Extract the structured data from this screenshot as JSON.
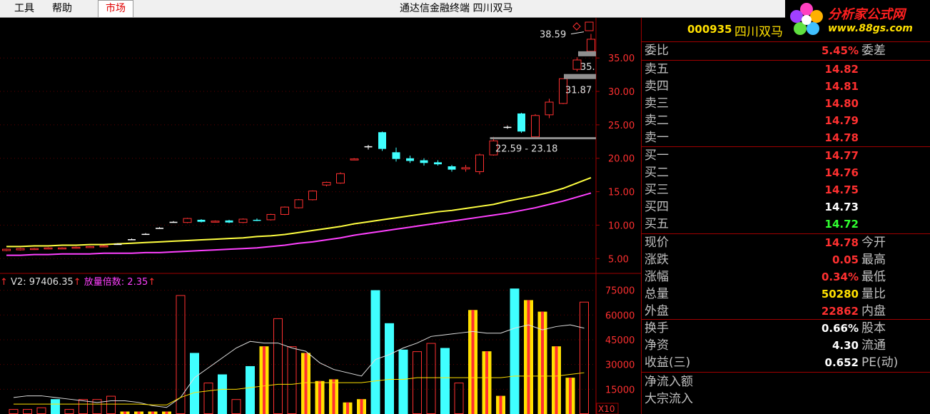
{
  "menu": {
    "tools": "工具",
    "help": "帮助",
    "market": "市场"
  },
  "window_title": "通达信金融终端  四川双马",
  "logo": {
    "text": "分析家公式网",
    "url": "www.88gs.com"
  },
  "stock": {
    "code": "000935",
    "name": "四川双马"
  },
  "quote_panel": {
    "ratio_label": "委比",
    "ratio_value": "5.45%",
    "diff_label": "委差",
    "asks": [
      {
        "label": "卖五",
        "price": "14.82"
      },
      {
        "label": "卖四",
        "price": "14.81"
      },
      {
        "label": "卖三",
        "price": "14.80"
      },
      {
        "label": "卖二",
        "price": "14.79"
      },
      {
        "label": "卖一",
        "price": "14.78"
      }
    ],
    "bids": [
      {
        "label": "买一",
        "price": "14.77"
      },
      {
        "label": "买二",
        "price": "14.76"
      },
      {
        "label": "买三",
        "price": "14.75"
      },
      {
        "label": "买四",
        "price": "14.73"
      },
      {
        "label": "买五",
        "price": "14.72"
      }
    ],
    "stats": [
      {
        "label": "现价",
        "value": "14.78",
        "label2": "今开"
      },
      {
        "label": "涨跌",
        "value": "0.05",
        "label2": "最高"
      },
      {
        "label": "涨幅",
        "value": "0.34%",
        "label2": "最低"
      },
      {
        "label": "总量",
        "value": "50280",
        "label2": "量比"
      },
      {
        "label": "外盘",
        "value": "22862",
        "label2": "内盘"
      }
    ],
    "stats2": [
      {
        "label": "换手",
        "value": "0.66%",
        "label2": "股本"
      },
      {
        "label": "净资",
        "value": "4.30",
        "label2": "流通"
      },
      {
        "label": "收益(三)",
        "value": "0.652",
        "label2": "PE(动)"
      }
    ],
    "flows": [
      {
        "label": "净流入额"
      },
      {
        "label": "大宗流入"
      }
    ],
    "colors": {
      "up": "#ff3030",
      "down": "#30ff30",
      "flat": "#ffffff",
      "volume": "#ffe000"
    }
  },
  "volume_legend": {
    "v2": "V2: 97406.35",
    "ratio": "放量倍数: 2.35"
  },
  "chart_data": {
    "type": "candlestick",
    "price_axis": {
      "ticks": [
        "35.00",
        "30.00",
        "25.00",
        "20.00",
        "15.00",
        "10.00",
        "5.00"
      ],
      "ylim": [
        3.0,
        41.0
      ]
    },
    "volume_axis": {
      "ticks": [
        "75000",
        "60000",
        "45000",
        "30000",
        "15000"
      ],
      "ylim": [
        0,
        80000
      ],
      "unit_label": "X10"
    },
    "annotations": {
      "high": "38.59",
      "mark1": "35.",
      "mark2": "31.87",
      "range": "22.59 - 23.18"
    },
    "candles": [
      {
        "o": 6.2,
        "c": 6.4,
        "h": 6.5,
        "l": 6.1
      },
      {
        "o": 6.3,
        "c": 6.5,
        "h": 6.6,
        "l": 6.2
      },
      {
        "o": 6.4,
        "c": 6.5,
        "h": 6.6,
        "l": 6.3
      },
      {
        "o": 6.5,
        "c": 6.6,
        "h": 6.7,
        "l": 6.4
      },
      {
        "o": 6.5,
        "c": 6.6,
        "h": 6.7,
        "l": 6.4
      },
      {
        "o": 6.6,
        "c": 6.7,
        "h": 6.8,
        "l": 6.5
      },
      {
        "o": 6.7,
        "c": 6.8,
        "h": 6.9,
        "l": 6.6
      },
      {
        "o": 6.8,
        "c": 6.9,
        "h": 7.0,
        "l": 6.7
      },
      {
        "o": 7.2,
        "c": 7.2,
        "h": 7.3,
        "l": 7.1
      },
      {
        "o": 7.9,
        "c": 7.9,
        "h": 8.0,
        "l": 7.8
      },
      {
        "o": 8.7,
        "c": 8.7,
        "h": 8.8,
        "l": 8.6
      },
      {
        "o": 9.6,
        "c": 9.6,
        "h": 9.7,
        "l": 9.5
      },
      {
        "o": 10.5,
        "c": 10.5,
        "h": 10.6,
        "l": 10.4
      },
      {
        "o": 10.4,
        "c": 11.0,
        "h": 11.1,
        "l": 10.3
      },
      {
        "o": 10.8,
        "c": 10.5,
        "h": 10.9,
        "l": 10.4
      },
      {
        "o": 10.5,
        "c": 10.6,
        "h": 10.7,
        "l": 10.4
      },
      {
        "o": 10.7,
        "c": 10.4,
        "h": 10.8,
        "l": 10.3
      },
      {
        "o": 10.4,
        "c": 10.9,
        "h": 11.0,
        "l": 10.3
      },
      {
        "o": 10.8,
        "c": 10.7,
        "h": 11.0,
        "l": 10.6
      },
      {
        "o": 10.8,
        "c": 11.6,
        "h": 11.7,
        "l": 10.7
      },
      {
        "o": 11.6,
        "c": 12.7,
        "h": 12.8,
        "l": 11.5
      },
      {
        "o": 12.6,
        "c": 13.8,
        "h": 13.9,
        "l": 12.5
      },
      {
        "o": 13.8,
        "c": 15.1,
        "h": 15.2,
        "l": 13.7
      },
      {
        "o": 16.0,
        "c": 16.4,
        "h": 16.5,
        "l": 15.8
      },
      {
        "o": 16.3,
        "c": 17.7,
        "h": 17.9,
        "l": 16.2
      },
      {
        "o": 19.8,
        "c": 19.9,
        "h": 20.0,
        "l": 19.7
      },
      {
        "o": 21.8,
        "c": 21.8,
        "h": 22.0,
        "l": 21.3
      },
      {
        "o": 23.9,
        "c": 21.4,
        "h": 24.0,
        "l": 21.1
      },
      {
        "o": 20.9,
        "c": 19.9,
        "h": 21.6,
        "l": 19.5
      },
      {
        "o": 20.0,
        "c": 19.6,
        "h": 20.4,
        "l": 19.3
      },
      {
        "o": 19.7,
        "c": 19.3,
        "h": 20.0,
        "l": 18.9
      },
      {
        "o": 19.4,
        "c": 19.1,
        "h": 19.7,
        "l": 18.9
      },
      {
        "o": 18.8,
        "c": 18.3,
        "h": 19.0,
        "l": 18.0
      },
      {
        "o": 18.4,
        "c": 18.6,
        "h": 19.0,
        "l": 18.0
      },
      {
        "o": 18.0,
        "c": 20.5,
        "h": 20.7,
        "l": 17.6
      },
      {
        "o": 20.5,
        "c": 22.6,
        "h": 23.2,
        "l": 20.4
      },
      {
        "o": 24.7,
        "c": 24.7,
        "h": 24.9,
        "l": 24.4
      },
      {
        "o": 26.7,
        "c": 24.0,
        "h": 26.8,
        "l": 23.8
      },
      {
        "o": 23.2,
        "c": 26.4,
        "h": 26.6,
        "l": 23.0
      },
      {
        "o": 26.5,
        "c": 28.4,
        "h": 28.9,
        "l": 26.0
      },
      {
        "o": 28.2,
        "c": 31.9,
        "h": 31.9,
        "l": 28.1
      },
      {
        "o": 33.3,
        "c": 34.7,
        "h": 35.1,
        "l": 33.0
      },
      {
        "o": 36.0,
        "c": 37.8,
        "h": 38.6,
        "l": 35.4
      }
    ],
    "ma_short": [
      6.8,
      6.8,
      6.9,
      6.9,
      7.0,
      7.0,
      7.1,
      7.1,
      7.2,
      7.3,
      7.4,
      7.5,
      7.6,
      7.7,
      7.8,
      7.9,
      8.0,
      8.1,
      8.3,
      8.4,
      8.6,
      8.9,
      9.2,
      9.5,
      9.8,
      10.2,
      10.5,
      10.8,
      11.1,
      11.4,
      11.7,
      12.0,
      12.2,
      12.5,
      12.8,
      13.1,
      13.6,
      14.0,
      14.4,
      14.9,
      15.5,
      16.3,
      17.1
    ],
    "ma_long": [
      5.5,
      5.5,
      5.6,
      5.6,
      5.7,
      5.7,
      5.7,
      5.8,
      5.8,
      5.8,
      5.9,
      5.9,
      6.0,
      6.1,
      6.2,
      6.3,
      6.4,
      6.5,
      6.6,
      6.8,
      7.0,
      7.3,
      7.5,
      7.8,
      8.1,
      8.5,
      8.8,
      9.1,
      9.4,
      9.7,
      10.0,
      10.3,
      10.6,
      10.9,
      11.2,
      11.5,
      11.8,
      12.2,
      12.6,
      13.1,
      13.6,
      14.2,
      14.8
    ],
    "volumes": [
      {
        "v": 3000,
        "k": "up"
      },
      {
        "v": 3000,
        "k": "up"
      },
      {
        "v": 4000,
        "k": "up"
      },
      {
        "v": 9000,
        "k": "down"
      },
      {
        "v": 3000,
        "k": "up"
      },
      {
        "v": 9000,
        "k": "up"
      },
      {
        "v": 9000,
        "k": "up"
      },
      {
        "v": 11000,
        "k": "up"
      },
      {
        "v": 1500,
        "k": "flat"
      },
      {
        "v": 1500,
        "k": "flat"
      },
      {
        "v": 1500,
        "k": "flat"
      },
      {
        "v": 1500,
        "k": "flat"
      },
      {
        "v": 72000,
        "k": "up"
      },
      {
        "v": 37000,
        "k": "down"
      },
      {
        "v": 19000,
        "k": "up"
      },
      {
        "v": 24000,
        "k": "down"
      },
      {
        "v": 9000,
        "k": "up"
      },
      {
        "v": 29000,
        "k": "down"
      },
      {
        "v": 41000,
        "k": "flat"
      },
      {
        "v": 58000,
        "k": "up"
      },
      {
        "v": 41000,
        "k": "up"
      },
      {
        "v": 37000,
        "k": "flat"
      },
      {
        "v": 20000,
        "k": "flat"
      },
      {
        "v": 21000,
        "k": "flat"
      },
      {
        "v": 7000,
        "k": "flat"
      },
      {
        "v": 9000,
        "k": "flat"
      },
      {
        "v": 75000,
        "k": "down"
      },
      {
        "v": 55000,
        "k": "down"
      },
      {
        "v": 39000,
        "k": "down"
      },
      {
        "v": 38000,
        "k": "up"
      },
      {
        "v": 43000,
        "k": "up"
      },
      {
        "v": 40000,
        "k": "down"
      },
      {
        "v": 19000,
        "k": "up"
      },
      {
        "v": 63000,
        "k": "flat"
      },
      {
        "v": 38000,
        "k": "flat"
      },
      {
        "v": 11000,
        "k": "flat"
      },
      {
        "v": 76000,
        "k": "down"
      },
      {
        "v": 69000,
        "k": "flat"
      },
      {
        "v": 62000,
        "k": "flat"
      },
      {
        "v": 41000,
        "k": "flat"
      },
      {
        "v": 22000,
        "k": "flat"
      },
      {
        "v": 68000,
        "k": "up"
      }
    ],
    "vol_ma1": [
      10000,
      11000,
      11000,
      10000,
      9000,
      8000,
      7000,
      8000,
      8000,
      7000,
      5000,
      4000,
      10000,
      22000,
      28000,
      34000,
      40000,
      44000,
      43000,
      43000,
      40000,
      38000,
      31000,
      27000,
      25000,
      23000,
      33000,
      36000,
      40000,
      43000,
      47000,
      48000,
      49000,
      50000,
      49000,
      49000,
      52000,
      54000,
      51000,
      53000,
      54000,
      52000
    ],
    "vol_ma2": [
      6000,
      6000,
      6000,
      6000,
      6000,
      6000,
      6000,
      6000,
      6000,
      6000,
      5500,
      5500,
      10000,
      13000,
      14000,
      15000,
      15000,
      16000,
      17000,
      18000,
      18000,
      19000,
      19000,
      19000,
      19000,
      19000,
      20000,
      21000,
      21000,
      22000,
      22000,
      22000,
      22000,
      22000,
      22000,
      22000,
      23000,
      23000,
      23000,
      23000,
      24000,
      25000
    ]
  }
}
